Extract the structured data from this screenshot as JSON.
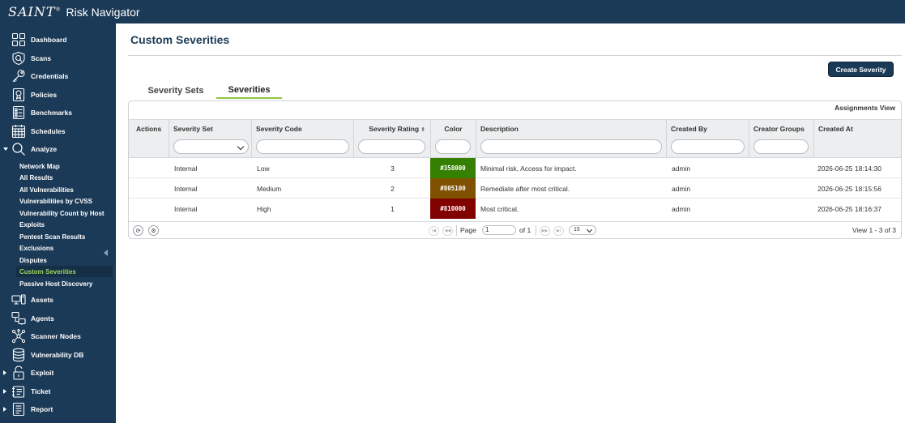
{
  "app": {
    "logo": "SAINT",
    "title": "Risk Navigator"
  },
  "sidebar": {
    "items": [
      {
        "label": "Dashboard",
        "icon": "dashboard-icon"
      },
      {
        "label": "Scans",
        "icon": "scans-icon"
      },
      {
        "label": "Credentials",
        "icon": "key-icon"
      },
      {
        "label": "Policies",
        "icon": "policy-icon"
      },
      {
        "label": "Benchmarks",
        "icon": "checklist-icon"
      },
      {
        "label": "Schedules",
        "icon": "calendar-icon"
      },
      {
        "label": "Analyze",
        "icon": "magnifier-icon"
      },
      {
        "label": "Assets",
        "icon": "assets-icon"
      },
      {
        "label": "Agents",
        "icon": "agents-icon"
      },
      {
        "label": "Scanner Nodes",
        "icon": "nodes-icon"
      },
      {
        "label": "Vulnerability DB",
        "icon": "database-icon"
      },
      {
        "label": "Exploit",
        "icon": "exploit-icon"
      },
      {
        "label": "Ticket",
        "icon": "ticket-icon"
      },
      {
        "label": "Report",
        "icon": "report-icon"
      }
    ],
    "analyze_sub": [
      "Network Map",
      "All Results",
      "All Vulnerabilities",
      "Vulnerabilities by CVSS",
      "Vulnerability Count by Host",
      "Exploits",
      "Pentest Scan Results",
      "Exclusions",
      "Disputes",
      "Custom Severities",
      "Passive Host Discovery"
    ],
    "active_sub": "Custom Severities"
  },
  "main": {
    "title": "Custom Severities",
    "create_button": "Create Severity",
    "tabs": [
      {
        "label": "Severity Sets",
        "active": false
      },
      {
        "label": "Severities",
        "active": true
      }
    ],
    "assignments_view": "Assignments View"
  },
  "table": {
    "columns": [
      "Actions",
      "Severity Set",
      "Severity Code",
      "Severity Rating",
      "Color",
      "Description",
      "Created By",
      "Creator Groups",
      "Created At"
    ],
    "rows": [
      {
        "actions": "",
        "set": "Internal",
        "code": "Low",
        "rating": "3",
        "color": "#358000",
        "description": "Minimal risk, Access for impact.",
        "created_by": "admin",
        "groups": "",
        "created_at": "2026-06-25 18:14:30"
      },
      {
        "actions": "",
        "set": "Internal",
        "code": "Medium",
        "rating": "2",
        "color": "#805100",
        "description": "Remediate after most critical.",
        "created_by": "admin",
        "groups": "",
        "created_at": "2026-06-25 18:15:56"
      },
      {
        "actions": "",
        "set": "Internal",
        "code": "High",
        "rating": "1",
        "color": "#810000",
        "description": "Most critical.",
        "created_by": "admin",
        "groups": "",
        "created_at": "2026-06-25 18:16:37"
      }
    ]
  },
  "pager": {
    "page_label": "Page",
    "page_value": "1",
    "of_label": "of 1",
    "page_size": "15",
    "view_text": "View 1 - 3 of 3"
  }
}
